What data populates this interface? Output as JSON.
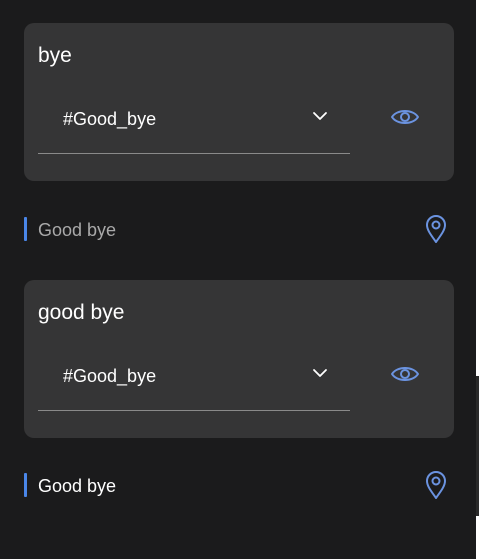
{
  "colors": {
    "background": "#1b1b1c",
    "card": "#353536",
    "accent": "#6b93e0",
    "bar": "#4a86e8",
    "text_primary": "#ffffff",
    "text_muted": "#a9a9a9"
  },
  "cards": [
    {
      "title": "bye",
      "selected": "#Good_bye",
      "icons": [
        "chevron-down-icon",
        "eye-icon"
      ]
    },
    {
      "title": "good bye",
      "selected": "#Good_bye",
      "icons": [
        "chevron-down-icon",
        "eye-icon"
      ]
    }
  ],
  "rows": [
    {
      "label": "Good bye",
      "icon": "map-pin-icon"
    },
    {
      "label": "Good bye",
      "icon": "map-pin-icon"
    }
  ]
}
